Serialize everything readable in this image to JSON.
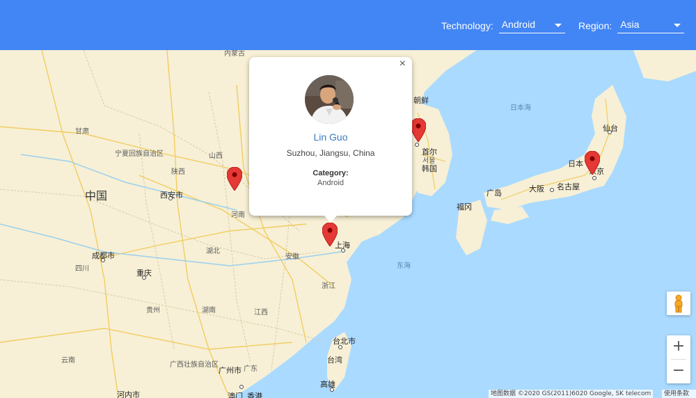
{
  "header": {
    "technology_label": "Technology:",
    "technology_value": "Android",
    "region_label": "Region:",
    "region_value": "Asia"
  },
  "map": {
    "labels": {
      "china": "中国",
      "xian": "西安市",
      "chengdu": "成都市",
      "chongqing": "重庆",
      "shanghai": "上海",
      "taipei": "台北市",
      "taiwan": "台湾",
      "kaohsiung": "高雄",
      "guangzhou": "广州市",
      "hongkong": "香港",
      "macau": "澳门",
      "hanoi": "河内市",
      "korea_n": "朝鲜",
      "seoul": "首尔",
      "seoul_ko": "서울",
      "korea_s": "韩国",
      "japan": "日本",
      "tokyo": "东京",
      "osaka": "大阪",
      "nagoya": "名古屋",
      "hiroshima": "广岛",
      "fukuoka": "福冈",
      "sendai": "仙台",
      "sea_of_japan": "日本海",
      "east_china_sea": "东海",
      "gansu": "甘肃",
      "ningxia": "宁夏回族自治区",
      "shanxi": "山西",
      "shaanxi": "陕西",
      "henan": "河南",
      "hubei": "湖北",
      "hunan": "湖南",
      "anhui": "安徽",
      "zhejiang": "浙江",
      "jiangxi": "江西",
      "guizhou": "贵州",
      "sichuan": "四川",
      "yunnan": "云南",
      "guangxi": "广西壮族自治区",
      "guangdong": "广东",
      "neimenggu": "内蒙古"
    },
    "attribution": "地图数据 ©2020 GS(2011)6020 Google, SK telecom",
    "terms": "使用条款"
  },
  "popup": {
    "name": "Lin Guo",
    "location": "Suzhou, Jiangsu, China",
    "category_label": "Category:",
    "category_value": "Android",
    "close_symbol": "×"
  },
  "controls": {
    "zoom_in": "+",
    "zoom_out": "−"
  },
  "icons": {
    "marker": "map-marker-icon",
    "pegman": "pegman-icon",
    "dropdown": "chevron-down-icon",
    "close": "close-icon"
  },
  "colors": {
    "header": "#4285f4",
    "marker": "#e53935",
    "link": "#3a7bbf",
    "water": "#aadaff",
    "land": "#f7f0d6"
  }
}
